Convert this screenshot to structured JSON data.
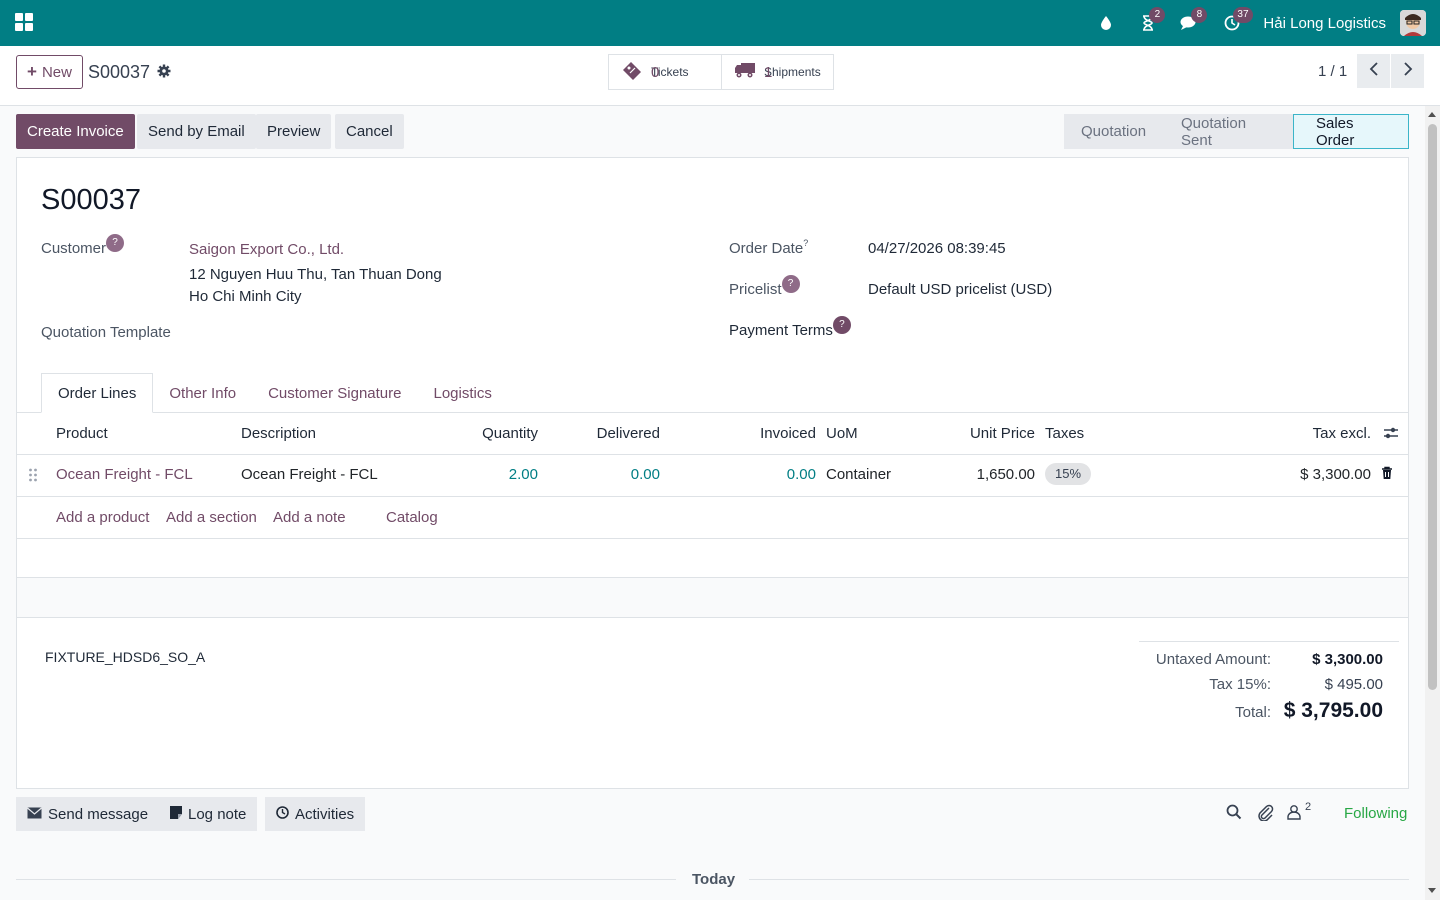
{
  "navbar": {
    "badges": {
      "activity": "2",
      "messages": "8",
      "clock": "37"
    },
    "company": "Hải Long Logistics",
    "icons": [
      "apps-icon",
      "drop-icon",
      "hourglass-icon",
      "chat-icon",
      "clock-icon"
    ]
  },
  "control": {
    "new_label": "New",
    "record_name": "S00037",
    "smart_buttons": [
      {
        "label": "Tickets",
        "value": "0",
        "icon": "ticket-icon"
      },
      {
        "label": "Shipments",
        "value": "1",
        "icon": "truck-icon"
      }
    ],
    "pager": "1 / 1"
  },
  "actions": {
    "create_invoice": "Create Invoice",
    "send_email": "Send by Email",
    "preview": "Preview",
    "cancel": "Cancel"
  },
  "stages": [
    "Quotation",
    "Quotation Sent",
    "Sales Order"
  ],
  "active_stage": "Sales Order",
  "form": {
    "title": "S00037",
    "customer_label": "Customer",
    "customer_name": "Saigon Export Co., Ltd.",
    "customer_addr1": "12 Nguyen Huu Thu, Tan Thuan Dong",
    "customer_addr2": "Ho Chi Minh City",
    "quotation_template_label": "Quotation Template",
    "order_date_label": "Order Date",
    "order_date_sup": "?",
    "order_date": "04/27/2026 08:39:45",
    "pricelist_label": "Pricelist",
    "pricelist": "Default USD pricelist (USD)",
    "payment_terms_label": "Payment Terms",
    "help_mark": "?"
  },
  "tabs": [
    "Order Lines",
    "Other Info",
    "Customer Signature",
    "Logistics"
  ],
  "table": {
    "headers": {
      "product": "Product",
      "description": "Description",
      "quantity": "Quantity",
      "delivered": "Delivered",
      "invoiced": "Invoiced",
      "uom": "UoM",
      "unit_price": "Unit Price",
      "taxes": "Taxes",
      "tax_excl": "Tax excl."
    },
    "rows": [
      {
        "product": "Ocean Freight - FCL",
        "description": "Ocean Freight - FCL",
        "quantity": "2.00",
        "delivered": "0.00",
        "invoiced": "0.00",
        "uom": "Container",
        "unit_price": "1,650.00",
        "taxes": "15%",
        "subtotal": "$ 3,300.00"
      }
    ],
    "add_links": [
      "Add a product",
      "Add a section",
      "Add a note",
      "Catalog"
    ]
  },
  "note": "FIXTURE_HDSD6_SO_A",
  "totals": {
    "untaxed_label": "Untaxed Amount:",
    "untaxed": "$ 3,300.00",
    "tax_label": "Tax 15%:",
    "tax": "$ 495.00",
    "total_label": "Total:",
    "total": "$ 3,795.00"
  },
  "chatter": {
    "send_message": "Send message",
    "log_note": "Log note",
    "activities": "Activities",
    "followers_count": "2",
    "following": "Following",
    "today": "Today"
  },
  "colors": {
    "navbar": "#017e84",
    "primary": "#714b67",
    "link_blue": "#017e84",
    "following_green": "#28a745"
  }
}
